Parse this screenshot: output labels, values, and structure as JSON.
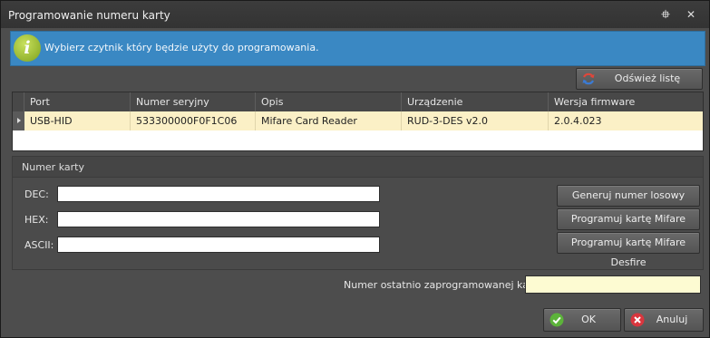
{
  "window": {
    "title": "Programowanie numeru karty",
    "pin_glyph": "⯐",
    "close_glyph": "✕"
  },
  "info_banner": {
    "icon": "info-icon",
    "icon_glyph": "i",
    "text": "Wybierz czytnik który będzie użyty do programowania.",
    "color": "#3a88c3"
  },
  "refresh_button": {
    "label": "Odśwież listę urzadzeń",
    "icon": "refresh-icon"
  },
  "devices_table": {
    "columns": [
      "Port",
      "Numer seryjny",
      "Opis",
      "Urządzenie",
      "Wersja firmware"
    ],
    "rows": [
      {
        "port": "USB-HID",
        "serial": "533300000F0F1C06",
        "description": "Mifare Card Reader",
        "device": "RUD-3-DES v2.0",
        "firmware": "2.0.4.023",
        "selected": true
      }
    ],
    "selected_row_color": "#fbf0c6"
  },
  "card_number": {
    "group_title": "Numer karty",
    "fields": [
      {
        "label": "DEC:",
        "value": ""
      },
      {
        "label": "HEX:",
        "value": ""
      },
      {
        "label": "ASCII:",
        "value": ""
      }
    ],
    "actions": [
      {
        "label": "Generuj numer losowy"
      },
      {
        "label": "Programuj kartę Mifare Classic"
      },
      {
        "label": "Programuj kartę Mifare Desfire"
      }
    ]
  },
  "last_programmed": {
    "label": "Numer ostatnio zaprogramowanej karty:",
    "value": ""
  },
  "footer": {
    "ok_label": "OK",
    "cancel_label": "Anuluj",
    "ok_icon_color": "#5cb33a",
    "cancel_icon_color": "#d9363e"
  }
}
